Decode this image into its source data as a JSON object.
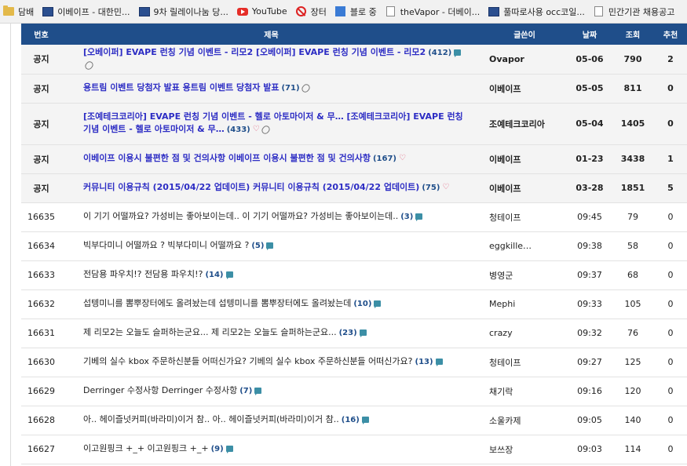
{
  "bookmarks": [
    {
      "label": "담배",
      "icon": "folder-icon"
    },
    {
      "label": "이베이프 - 대한민...",
      "icon": "site-icon"
    },
    {
      "label": "9차 릴레이나눔 당...",
      "icon": "site-icon"
    },
    {
      "label": "YouTube",
      "icon": "youtube-icon"
    },
    {
      "label": "장터",
      "icon": "ban-icon"
    },
    {
      "label": "블로 중",
      "icon": "blue-square-icon"
    },
    {
      "label": "theVapor - 더베이...",
      "icon": "page-icon"
    },
    {
      "label": "풀따로사용 occ코일...",
      "icon": "site-icon"
    },
    {
      "label": "민간기관 채용공고",
      "icon": "page-icon"
    }
  ],
  "board": {
    "headers": {
      "num": "번호",
      "title": "제목",
      "writer": "글쓴이",
      "date": "날짜",
      "views": "조회",
      "rec": "추천"
    },
    "notice_rows": [
      {
        "num": "공지",
        "title": "[오베이퍼] EVAPE 런칭 기념 이벤트 - 리모2 [오베이퍼] EVAPE 런칭 기념 이벤트 - 리모2",
        "comments": "(412)",
        "icons": [
          "chat-icon",
          "clip-icon"
        ],
        "writer": "Ovapor",
        "date": "05-06",
        "views": "790",
        "rec": "2"
      },
      {
        "num": "공지",
        "title": "용트림 이벤트 당첨자 발표 용트림 이벤트 당첨자 발표",
        "comments": "(71)",
        "icons": [
          "clip-icon"
        ],
        "writer": "이베이프",
        "date": "05-05",
        "views": "811",
        "rec": "0"
      },
      {
        "num": "공지",
        "title": "[조예테크코리아] EVAPE 런칭 기념 이벤트 - 헬로 아토마이저 & 무… [조예테크코리아] EVAPE 런칭 기념 이벤트 - 헬로 아토마이저 & 무…",
        "comments": "(433)",
        "icons": [
          "heart-icon",
          "clip-icon"
        ],
        "writer": "조예테크코리아",
        "date": "05-04",
        "views": "1405",
        "rec": "0"
      },
      {
        "num": "공지",
        "title": "이베이프 이용시 불편한 점 및 건의사항 이베이프 이용시 불편한 점 및 건의사항",
        "comments": "(167)",
        "icons": [
          "heart-icon"
        ],
        "writer": "이베이프",
        "date": "01-23",
        "views": "3438",
        "rec": "1"
      },
      {
        "num": "공지",
        "title": "커뮤니티 이용규칙 (2015/04/22 업데이트) 커뮤니티 이용규칙 (2015/04/22 업데이트)",
        "comments": "(75)",
        "icons": [
          "heart-icon"
        ],
        "writer": "이베이프",
        "date": "03-28",
        "views": "1851",
        "rec": "5"
      }
    ],
    "rows": [
      {
        "num": "16635",
        "title": "이 기기 어떨까요? 가성비는 좋아보이는데.. 이 기기 어떨까요? 가성비는 좋아보이는데..",
        "comments": "(3)",
        "writer": "청테이프",
        "date": "09:45",
        "views": "79",
        "rec": "0"
      },
      {
        "num": "16634",
        "title": "빅부다미니 어떨까요 ? 빅부다미니 어떨까요 ?",
        "comments": "(5)",
        "writer": "eggkille…",
        "date": "09:38",
        "views": "58",
        "rec": "0"
      },
      {
        "num": "16633",
        "title": "전담용 파우치!? 전담용 파우치!?",
        "comments": "(14)",
        "writer": "병영군",
        "date": "09:37",
        "views": "68",
        "rec": "0"
      },
      {
        "num": "16632",
        "title": "섭텡미니를 뽐뿌장터에도 올려놨는데 섭텡미니를 뽐뿌장터에도 올려놨는데",
        "comments": "(10)",
        "writer": "Mephi",
        "date": "09:33",
        "views": "105",
        "rec": "0"
      },
      {
        "num": "16631",
        "title": "제 리모2는 오늘도 슬퍼하는군요... 제 리모2는 오늘도 슬퍼하는군요...",
        "comments": "(23)",
        "writer": "crazy",
        "date": "09:32",
        "views": "76",
        "rec": "0"
      },
      {
        "num": "16630",
        "title": "기베의 실수 kbox 주문하신분들 어떠신가요? 기베의 실수 kbox 주문하신분들 어떠신가요?",
        "comments": "(13)",
        "writer": "청테이프",
        "date": "09:27",
        "views": "125",
        "rec": "0"
      },
      {
        "num": "16629",
        "title": "Derringer 수정사항 Derringer 수정사항",
        "comments": "(7)",
        "writer": "채기락",
        "date": "09:16",
        "views": "120",
        "rec": "0"
      },
      {
        "num": "16628",
        "title": "아.. 헤이즐넛커피(바라미)이거 참.. 아.. 헤이즐넛커피(바라미)이거 참..",
        "comments": "(16)",
        "writer": "소울카제",
        "date": "09:05",
        "views": "140",
        "rec": "0"
      },
      {
        "num": "16627",
        "title": "이고원핑크 +_+ 이고원핑크 +_+",
        "comments": "(9)",
        "writer": "보쓰장",
        "date": "09:03",
        "views": "114",
        "rec": "0"
      }
    ]
  }
}
